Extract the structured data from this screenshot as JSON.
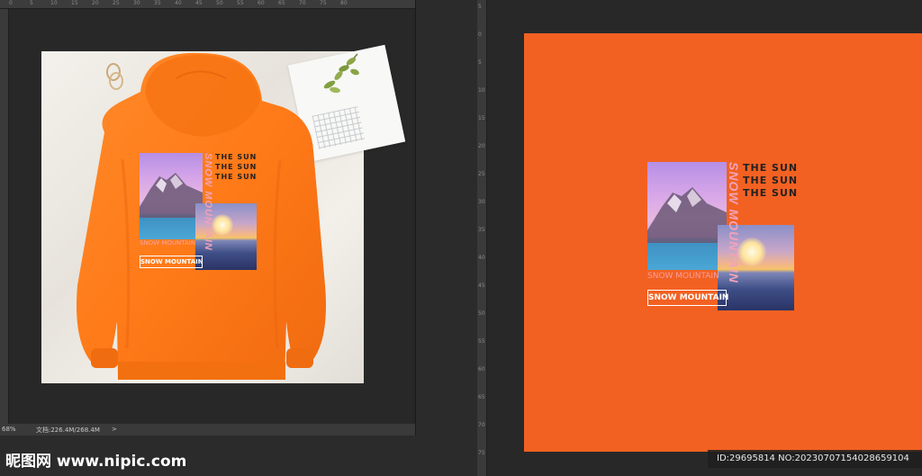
{
  "left_document": {
    "ruler_top_ticks": [
      "0",
      "5",
      "10",
      "15",
      "20",
      "25",
      "30",
      "35",
      "40",
      "45",
      "50",
      "55",
      "60",
      "65",
      "70",
      "75",
      "80"
    ],
    "status": {
      "zoom": "68%",
      "doc_info": "文档:226.4M/268.4M",
      "arrow": ">"
    }
  },
  "right_document": {
    "ruler_side_ticks": [
      "5",
      "0",
      "5",
      "10",
      "15",
      "20",
      "25",
      "30",
      "35",
      "40",
      "45",
      "50",
      "55",
      "60",
      "65",
      "70",
      "75"
    ]
  },
  "design": {
    "vertical_text": "SNOW MOUNTAIN",
    "sun_lines": [
      "THE SUN",
      "THE SUN",
      "THE SUN"
    ],
    "ghost_text": "SNOW MOUNTAIN",
    "boxed_text": "SNOW MOUNTAIN"
  },
  "colors": {
    "orange_canvas": "#f26122",
    "hoodie": "#ff7a1a"
  },
  "watermark": {
    "site": "昵图网 www.nipic.com"
  },
  "image_id": "ID:29695814 NO:20230707154028659104",
  "icons": [
    "ring-icon",
    "leaf-icon"
  ]
}
